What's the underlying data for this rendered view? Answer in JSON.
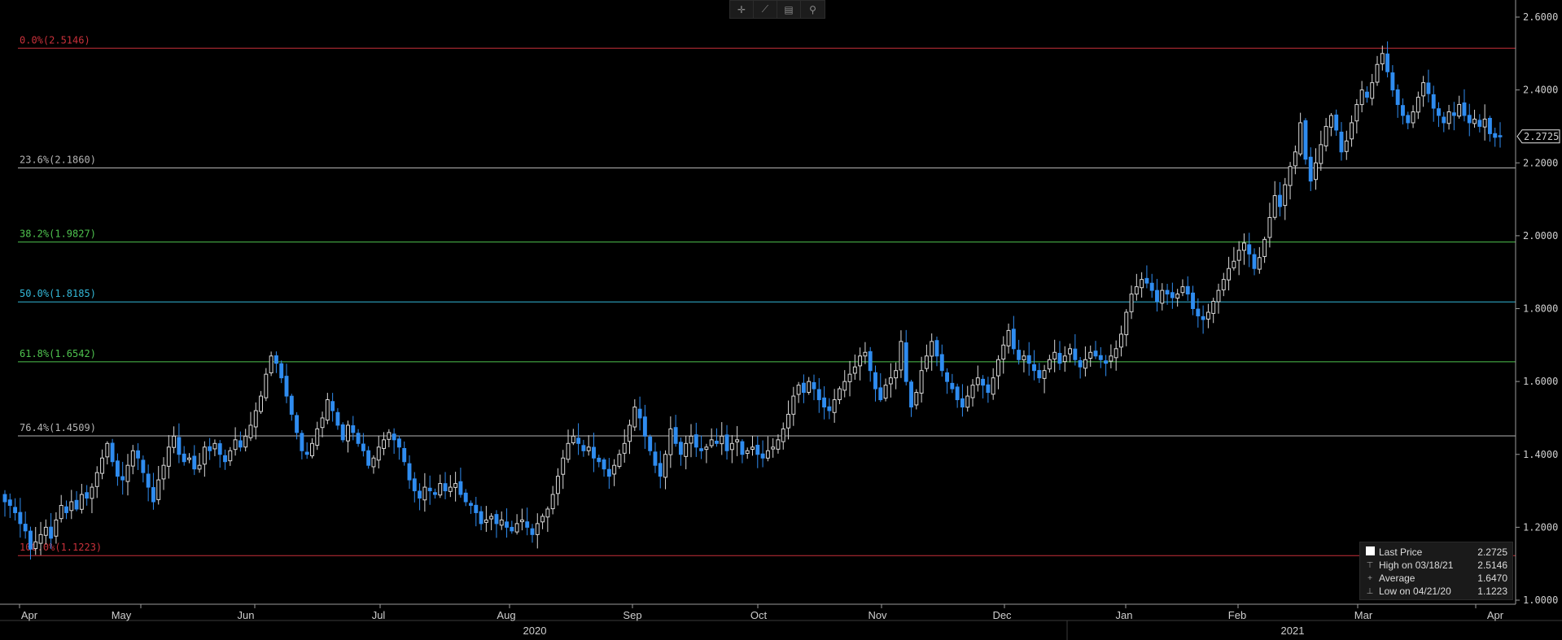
{
  "toolbar": {
    "tools": [
      {
        "name": "crosshair-icon",
        "glyph": "✛"
      },
      {
        "name": "draw-line-icon",
        "glyph": "⟋"
      },
      {
        "name": "table-icon",
        "glyph": "▤"
      },
      {
        "name": "zoom-icon",
        "glyph": "⚲"
      }
    ]
  },
  "legend": {
    "items": [
      {
        "symbol": "box",
        "label": "Last Price",
        "value": "2.2725"
      },
      {
        "symbol": "⊤",
        "label": "High on 03/18/21",
        "value": "2.5146"
      },
      {
        "symbol": "+",
        "label": "Average",
        "value": "1.6470"
      },
      {
        "symbol": "⊥",
        "label": "Low on 04/21/20",
        "value": "1.1223"
      }
    ]
  },
  "chart_data": {
    "type": "candlestick",
    "ylim": [
      1.0,
      2.6
    ],
    "y_ticks": [
      "1.0000",
      "1.2000",
      "1.4000",
      "1.6000",
      "1.8000",
      "2.0000",
      "2.2000",
      "2.4000",
      "2.6000"
    ],
    "last_price_tag": "2.2725",
    "last_price": 2.2725,
    "x_month_labels": [
      "Apr",
      "May",
      "Jun",
      "Jul",
      "Aug",
      "Sep",
      "Oct",
      "Nov",
      "Dec",
      "Jan",
      "Feb",
      "Mar",
      "Apr"
    ],
    "x_year_labels": [
      "2020",
      "2021"
    ],
    "fib_levels": [
      {
        "label": "0.0%(2.5146)",
        "value": 2.5146,
        "color": "#c8303a"
      },
      {
        "label": "23.6%(2.1860)",
        "value": 2.186,
        "color": "#b4b4b4"
      },
      {
        "label": "38.2%(1.9827)",
        "value": 1.9827,
        "color": "#4ec24e"
      },
      {
        "label": "50.0%(1.8185)",
        "value": 1.8185,
        "color": "#33b8d8"
      },
      {
        "label": "61.8%(1.6542)",
        "value": 1.6542,
        "color": "#4ec24e"
      },
      {
        "label": "76.4%(1.4509)",
        "value": 1.4509,
        "color": "#b4b4b4"
      },
      {
        "label": "100.0%(1.1223)",
        "value": 1.1223,
        "color": "#c8303a"
      }
    ],
    "closes": [
      1.27,
      1.26,
      1.24,
      1.21,
      1.19,
      1.14,
      1.16,
      1.18,
      1.2,
      1.17,
      1.22,
      1.26,
      1.24,
      1.27,
      1.25,
      1.29,
      1.28,
      1.31,
      1.35,
      1.39,
      1.43,
      1.38,
      1.34,
      1.33,
      1.37,
      1.41,
      1.39,
      1.35,
      1.31,
      1.27,
      1.33,
      1.37,
      1.42,
      1.45,
      1.4,
      1.38,
      1.39,
      1.36,
      1.37,
      1.42,
      1.41,
      1.43,
      1.4,
      1.38,
      1.41,
      1.44,
      1.42,
      1.45,
      1.48,
      1.52,
      1.56,
      1.62,
      1.67,
      1.65,
      1.61,
      1.56,
      1.51,
      1.46,
      1.41,
      1.4,
      1.43,
      1.47,
      1.5,
      1.55,
      1.52,
      1.48,
      1.44,
      1.48,
      1.46,
      1.43,
      1.41,
      1.37,
      1.39,
      1.42,
      1.44,
      1.46,
      1.44,
      1.42,
      1.38,
      1.33,
      1.3,
      1.28,
      1.31,
      1.3,
      1.29,
      1.32,
      1.3,
      1.31,
      1.32,
      1.29,
      1.27,
      1.26,
      1.24,
      1.21,
      1.22,
      1.23,
      1.21,
      1.22,
      1.2,
      1.19,
      1.21,
      1.22,
      1.2,
      1.18,
      1.21,
      1.23,
      1.25,
      1.29,
      1.34,
      1.39,
      1.43,
      1.45,
      1.43,
      1.41,
      1.42,
      1.39,
      1.38,
      1.36,
      1.34,
      1.37,
      1.4,
      1.43,
      1.48,
      1.53,
      1.5,
      1.45,
      1.41,
      1.37,
      1.34,
      1.4,
      1.47,
      1.43,
      1.4,
      1.43,
      1.45,
      1.42,
      1.41,
      1.42,
      1.44,
      1.43,
      1.45,
      1.41,
      1.43,
      1.44,
      1.4,
      1.41,
      1.42,
      1.4,
      1.39,
      1.41,
      1.42,
      1.44,
      1.47,
      1.51,
      1.56,
      1.59,
      1.57,
      1.6,
      1.58,
      1.55,
      1.53,
      1.52,
      1.55,
      1.58,
      1.6,
      1.62,
      1.64,
      1.67,
      1.68,
      1.63,
      1.58,
      1.55,
      1.59,
      1.61,
      1.63,
      1.71,
      1.6,
      1.53,
      1.57,
      1.63,
      1.67,
      1.71,
      1.67,
      1.63,
      1.6,
      1.58,
      1.55,
      1.53,
      1.56,
      1.59,
      1.61,
      1.59,
      1.57,
      1.61,
      1.66,
      1.7,
      1.74,
      1.69,
      1.66,
      1.67,
      1.65,
      1.63,
      1.61,
      1.63,
      1.66,
      1.68,
      1.65,
      1.67,
      1.69,
      1.66,
      1.64,
      1.66,
      1.68,
      1.67,
      1.66,
      1.65,
      1.67,
      1.69,
      1.73,
      1.79,
      1.84,
      1.86,
      1.88,
      1.87,
      1.85,
      1.82,
      1.85,
      1.84,
      1.83,
      1.84,
      1.86,
      1.84,
      1.8,
      1.78,
      1.77,
      1.79,
      1.82,
      1.85,
      1.88,
      1.91,
      1.93,
      1.96,
      1.98,
      1.95,
      1.91,
      1.94,
      1.99,
      2.05,
      2.11,
      2.08,
      2.14,
      2.19,
      2.23,
      2.31,
      2.21,
      2.15,
      2.2,
      2.25,
      2.3,
      2.33,
      2.29,
      2.23,
      2.26,
      2.31,
      2.36,
      2.4,
      2.38,
      2.42,
      2.47,
      2.5,
      2.45,
      2.4,
      2.36,
      2.33,
      2.31,
      2.34,
      2.38,
      2.42,
      2.39,
      2.35,
      2.33,
      2.31,
      2.34,
      2.33,
      2.36,
      2.33,
      2.31,
      2.32,
      2.3,
      2.32,
      2.28,
      2.27,
      2.2725
    ]
  }
}
